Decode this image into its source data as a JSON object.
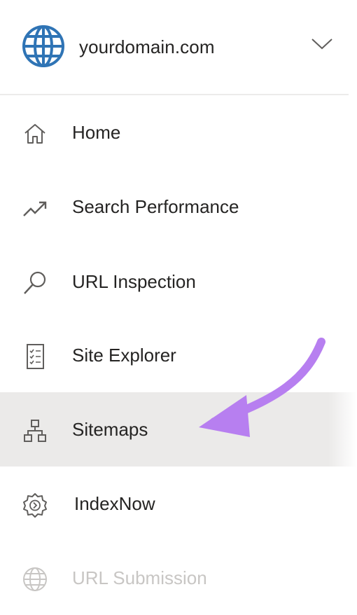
{
  "header": {
    "site_name": "yourdomain.com",
    "site_icon": "globe-icon",
    "dropdown_icon": "chevron-down-icon"
  },
  "nav": {
    "items": [
      {
        "label": "Home",
        "icon": "home-icon",
        "selected": false,
        "disabled": false
      },
      {
        "label": "Search Performance",
        "icon": "trending-up-icon",
        "selected": false,
        "disabled": false
      },
      {
        "label": "URL Inspection",
        "icon": "search-icon",
        "selected": false,
        "disabled": false
      },
      {
        "label": "Site Explorer",
        "icon": "checklist-icon",
        "selected": false,
        "disabled": false
      },
      {
        "label": "Sitemaps",
        "icon": "sitemap-icon",
        "selected": true,
        "disabled": false
      },
      {
        "label": "IndexNow",
        "icon": "gear-icon",
        "selected": false,
        "disabled": false
      },
      {
        "label": "URL Submission",
        "icon": "globe-icon",
        "selected": false,
        "disabled": true
      }
    ]
  },
  "annotation": {
    "arrow_color": "#b77ff0",
    "points_to": "Sitemaps"
  },
  "colors": {
    "globe_blue": "#2f74b5",
    "selected_bg": "#ebeae9",
    "text": "#252423",
    "disabled_text": "#c8c6c4"
  }
}
